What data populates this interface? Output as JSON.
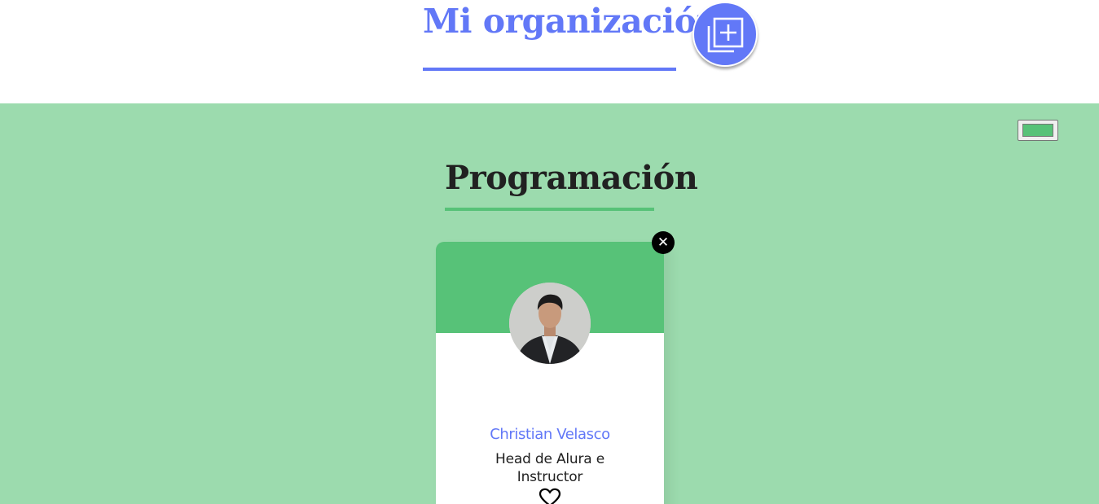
{
  "header": {
    "title": "Mi organización",
    "add_icon": "add-copy-icon",
    "accent_color": "#6278f7"
  },
  "team": {
    "title": "Programación",
    "primary_color": "#57c278",
    "background_color": "#9cdbae",
    "color_picker_value": "#57c278"
  },
  "members": [
    {
      "name": "Christian Velasco",
      "role": "Head de Alura e Instructor",
      "delete_icon": "close-icon",
      "favorite_icon": "heart-outline-icon"
    }
  ]
}
